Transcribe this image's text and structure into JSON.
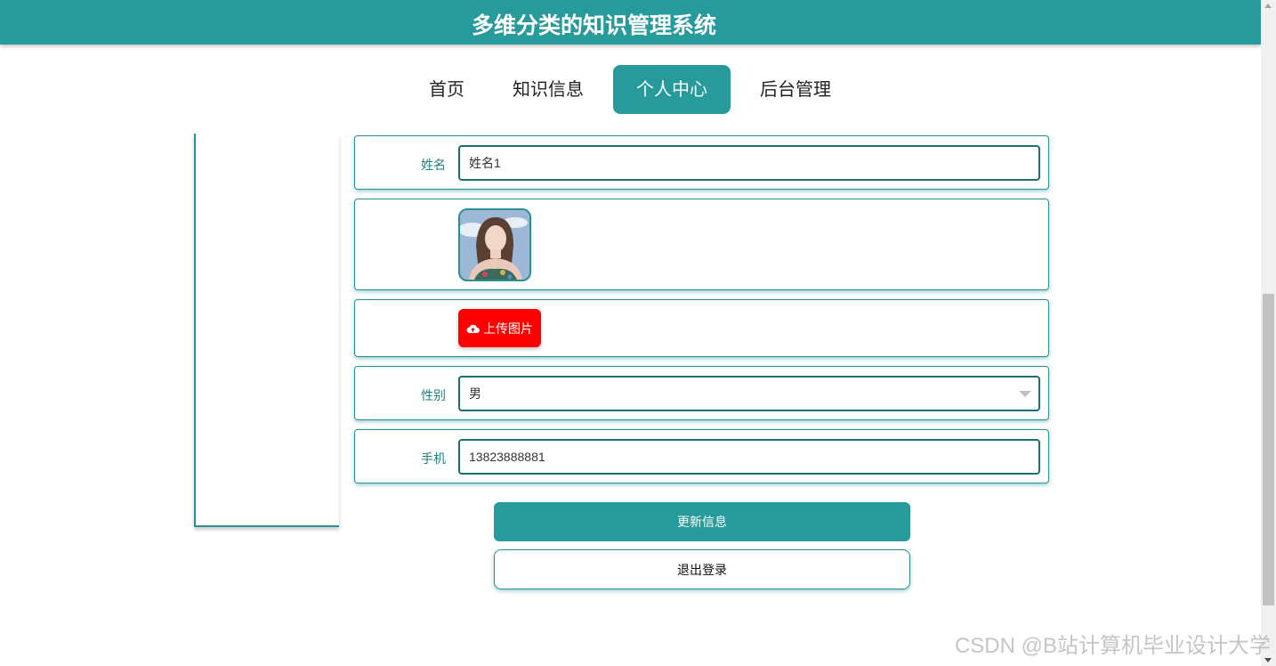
{
  "header": {
    "title": "多维分类的知识管理系统"
  },
  "nav": {
    "items": [
      {
        "label": "首页"
      },
      {
        "label": "知识信息"
      },
      {
        "label": "个人中心"
      },
      {
        "label": "后台管理"
      }
    ],
    "active_index": 2
  },
  "form": {
    "name": {
      "label": "姓名",
      "value": "姓名1"
    },
    "avatar": {
      "alt": "avatar"
    },
    "upload": {
      "label": "上传图片",
      "icon": "cloud-upload-icon"
    },
    "gender": {
      "label": "性别",
      "value": "男"
    },
    "phone": {
      "label": "手机",
      "value": "13823888881"
    }
  },
  "actions": {
    "update_label": "更新信息",
    "logout_label": "退出登录"
  },
  "watermark": "CSDN @B站计算机毕业设计大学",
  "colors": {
    "primary": "#279a9c",
    "upload": "#ff0000"
  }
}
